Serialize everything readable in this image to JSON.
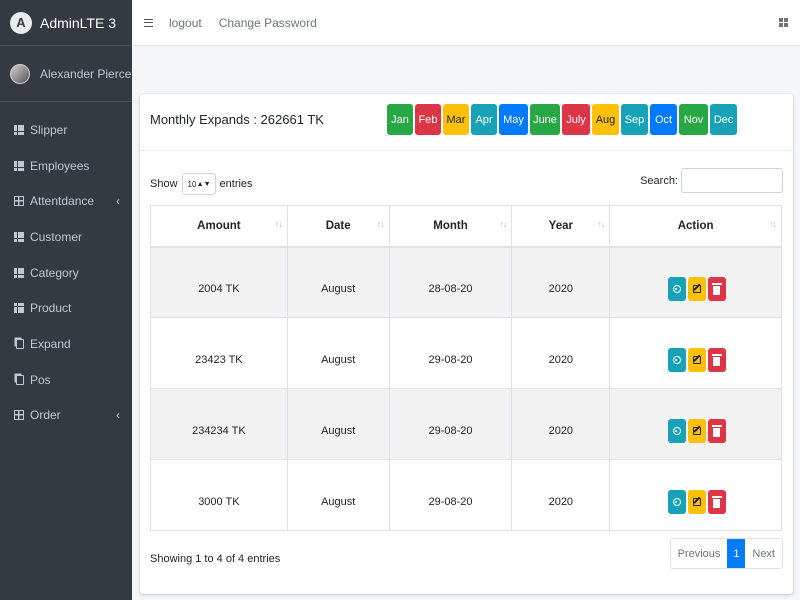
{
  "brand": {
    "logo_letter": "A",
    "title": "AdminLTE 3"
  },
  "user": {
    "name": "Alexander Pierce"
  },
  "sidebar": {
    "items": [
      {
        "label": "Slipper",
        "icon": "grid-icon"
      },
      {
        "label": "Employees",
        "icon": "grid-icon"
      },
      {
        "label": "Attentdance",
        "icon": "table-icon",
        "has_children": true
      },
      {
        "label": "Customer",
        "icon": "grid-icon"
      },
      {
        "label": "Category",
        "icon": "grid-icon"
      },
      {
        "label": "Product",
        "icon": "grid-icon"
      },
      {
        "label": "Expand",
        "icon": "copy-icon"
      },
      {
        "label": "Pos",
        "icon": "copy-icon"
      },
      {
        "label": "Order",
        "icon": "table-icon",
        "has_children": true
      }
    ],
    "chevron": "‹"
  },
  "topnav": {
    "logout": "logout",
    "change_password": "Change Password"
  },
  "card": {
    "title": "Monthly Expands : 262661 TK",
    "months": [
      {
        "label": "Jan",
        "color": "#28a745"
      },
      {
        "label": "Feb",
        "color": "#dc3545"
      },
      {
        "label": "Mar",
        "color": "#ffc107"
      },
      {
        "label": "Apr",
        "color": "#17a2b8"
      },
      {
        "label": "May",
        "color": "#007bff"
      },
      {
        "label": "June",
        "color": "#28a745"
      },
      {
        "label": "July",
        "color": "#dc3545"
      },
      {
        "label": "Aug",
        "color": "#ffc107"
      },
      {
        "label": "Sep",
        "color": "#17a2b8"
      },
      {
        "label": "Oct",
        "color": "#007bff"
      },
      {
        "label": "Nov",
        "color": "#28a745"
      },
      {
        "label": "Dec",
        "color": "#17a2b8"
      }
    ]
  },
  "controls": {
    "show_label": "Show",
    "entries_value": "10",
    "entries_label": "entries",
    "search_label": "Search:"
  },
  "table": {
    "columns": [
      "Amount",
      "Date",
      "Month",
      "Year",
      "Action"
    ],
    "sort_glyph": "↑↓",
    "rows": [
      {
        "amount": "2004 TK",
        "month": "August",
        "date": "28-08-20",
        "year": "2020"
      },
      {
        "amount": "23423 TK",
        "month": "August",
        "date": "29-08-20",
        "year": "2020"
      },
      {
        "amount": "234234 TK",
        "month": "August",
        "date": "29-08-20",
        "year": "2020"
      },
      {
        "amount": "3000 TK",
        "month": "August",
        "date": "29-08-20",
        "year": "2020"
      }
    ]
  },
  "footer": {
    "info": "Showing 1 to 4 of 4 entries",
    "previous": "Previous",
    "page": "1",
    "next": "Next"
  }
}
